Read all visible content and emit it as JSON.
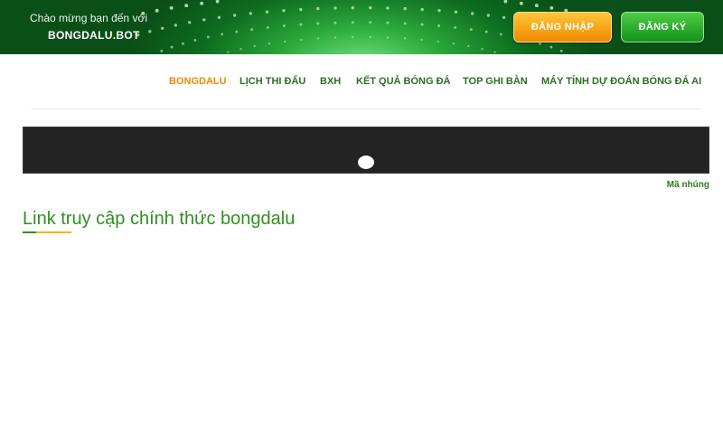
{
  "header": {
    "welcome_text": "Chào mừng bạn đến với",
    "site_name": "BONGDALU.BOT",
    "login_label": "ĐĂNG NHẬP",
    "register_label": "ĐĂNG KÝ"
  },
  "nav": {
    "items": [
      {
        "label": "BONGDALU",
        "active": true
      },
      {
        "label": "LỊCH THI ĐẤU",
        "active": false
      },
      {
        "label": "BXH",
        "active": false
      },
      {
        "label": "KẾT QUẢ BÓNG ĐÁ",
        "active": false
      },
      {
        "label": "TOP GHI BÀN",
        "active": false
      },
      {
        "label": "MÁY TÍNH DỰ ĐOÁN BÓNG ĐÁ AI",
        "active": false
      }
    ]
  },
  "video": {
    "embed_label": "Mã nhúng"
  },
  "main": {
    "heading": "Link truy cập chính thức bongdalu"
  },
  "colors": {
    "brand_green": "#2f8f1f",
    "accent_orange": "#f08a00"
  }
}
